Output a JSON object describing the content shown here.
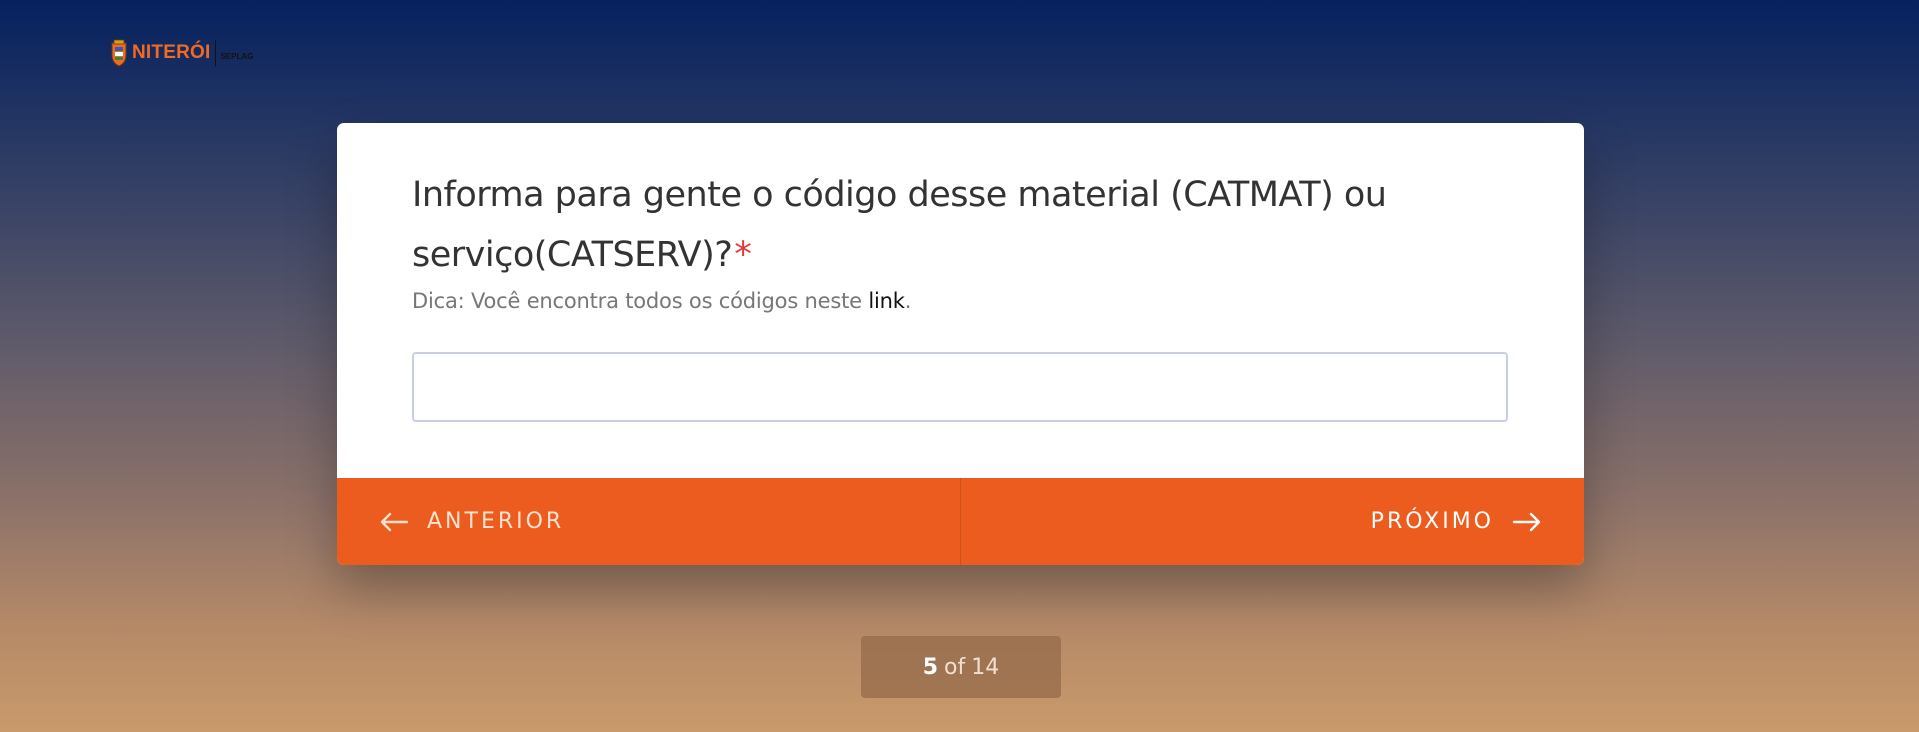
{
  "header": {
    "logo_city": "NITERÓI",
    "logo_dept": "SEPLAG"
  },
  "question": {
    "text": "Informa para gente o código desse material (CATMAT) ou serviço(CATSERV)?",
    "required_mark": "*",
    "hint_prefix": "Dica: Você encontra todos os códigos neste ",
    "hint_link": "link",
    "hint_suffix": ".",
    "input_value": "",
    "input_placeholder": ""
  },
  "navigation": {
    "prev_label": "ANTERIOR",
    "next_label": "PRÓXIMO",
    "prev_icon": "arrow-left-icon",
    "next_icon": "arrow-right-icon"
  },
  "progress": {
    "current": "5",
    "separator": "of",
    "total": "14"
  },
  "colors": {
    "accent": "#ec5c1f",
    "required": "#e5383b",
    "logo": "#f26a21",
    "background_top": "#05215f",
    "background_bottom": "#c99a6b"
  }
}
